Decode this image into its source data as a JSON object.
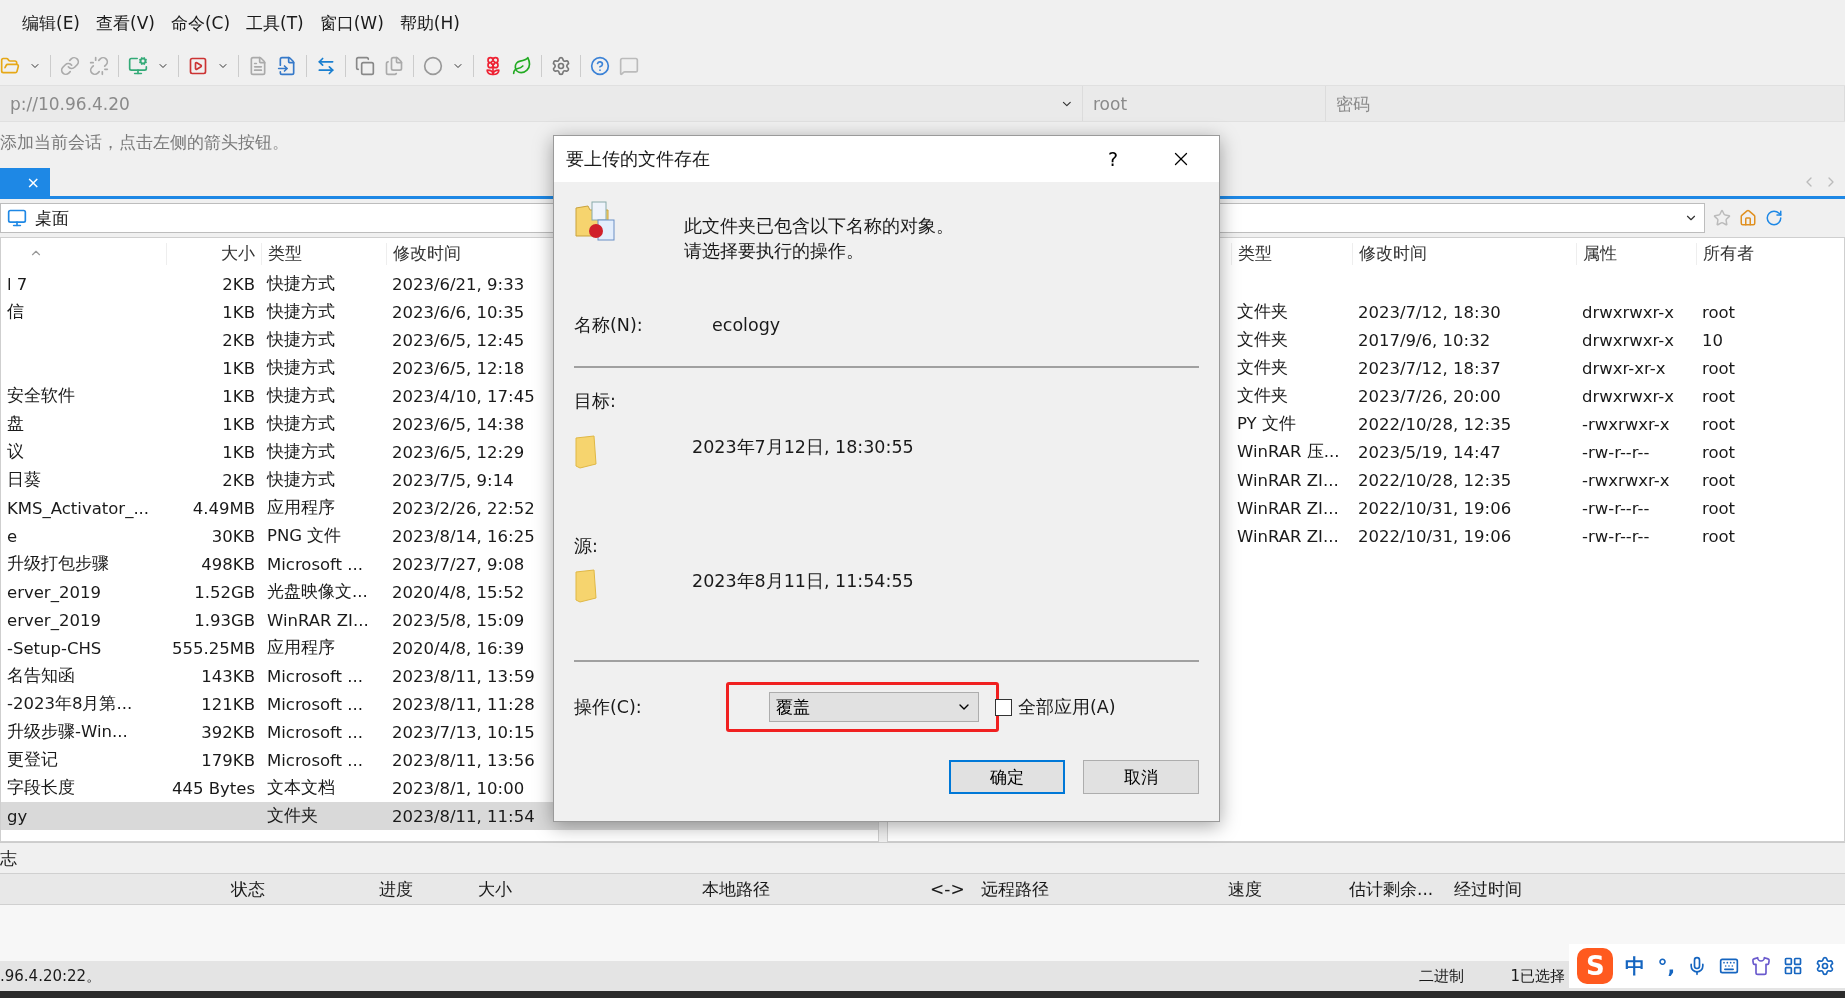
{
  "menu": [
    "编辑(E)",
    "查看(V)",
    "命令(C)",
    "工具(T)",
    "窗口(W)",
    "帮助(H)"
  ],
  "session": {
    "address": "p://10.96.4.20",
    "user": "root",
    "password_placeholder": "密码"
  },
  "hint": "添加当前会话，点击左侧的箭头按钮。",
  "session_tab": {
    "close": "×",
    "selected": true
  },
  "local_panel": {
    "path": "桌面",
    "columns": [
      "大小",
      "类型",
      "修改时间"
    ],
    "rows": [
      {
        "name": "l 7",
        "size": "2KB",
        "type": "快捷方式",
        "modified": "2023/6/21, 9:33",
        "selected": false
      },
      {
        "name": "信",
        "size": "1KB",
        "type": "快捷方式",
        "modified": "2023/6/6, 10:35",
        "selected": false
      },
      {
        "size": "2KB",
        "type": "快捷方式",
        "modified": "2023/6/5, 12:45",
        "selected": false
      },
      {
        "size": "1KB",
        "type": "快捷方式",
        "modified": "2023/6/5, 12:18",
        "selected": false
      },
      {
        "name": "安全软件",
        "size": "1KB",
        "type": "快捷方式",
        "modified": "2023/4/10, 17:45",
        "selected": false
      },
      {
        "name": "盘",
        "size": "1KB",
        "type": "快捷方式",
        "modified": "2023/6/5, 14:38",
        "selected": false
      },
      {
        "name": "议",
        "size": "1KB",
        "type": "快捷方式",
        "modified": "2023/6/5, 12:29",
        "selected": false
      },
      {
        "name": "日葵",
        "size": "2KB",
        "type": "快捷方式",
        "modified": "2023/7/5, 9:14",
        "selected": false
      },
      {
        "name": "KMS_Activator_...",
        "size": "4.49MB",
        "type": "应用程序",
        "modified": "2023/2/26, 22:52",
        "selected": false
      },
      {
        "name": "e",
        "size": "30KB",
        "type": "PNG 文件",
        "modified": "2023/8/14, 16:25",
        "selected": false
      },
      {
        "name": "升级打包步骤",
        "size": "498KB",
        "type": "Microsoft ...",
        "modified": "2023/7/27, 9:08",
        "selected": false
      },
      {
        "name": "erver_2019",
        "size": "1.52GB",
        "type": "光盘映像文...",
        "modified": "2020/4/8, 15:52",
        "selected": false
      },
      {
        "name": "erver_2019",
        "size": "1.93GB",
        "type": "WinRAR ZI...",
        "modified": "2023/5/8, 15:09",
        "selected": false
      },
      {
        "name": "-Setup-CHS",
        "size": "555.25MB",
        "type": "应用程序",
        "modified": "2020/4/8, 16:39",
        "selected": false
      },
      {
        "name": "名告知函",
        "size": "143KB",
        "type": "Microsoft ...",
        "modified": "2023/8/11, 13:59",
        "selected": false
      },
      {
        "name": "-2023年8月第...",
        "size": "121KB",
        "type": "Microsoft ...",
        "modified": "2023/8/11, 11:28",
        "selected": false
      },
      {
        "name": "升级步骤-Win...",
        "size": "392KB",
        "type": "Microsoft ...",
        "modified": "2023/7/13, 10:15",
        "selected": false
      },
      {
        "name": "更登记",
        "size": "179KB",
        "type": "Microsoft ...",
        "modified": "2023/8/11, 13:56",
        "selected": false
      },
      {
        "name": "字段长度",
        "size": "445 Bytes",
        "type": "文本文档",
        "modified": "2023/8/1, 10:00",
        "selected": false
      },
      {
        "name": "gy",
        "type": "文件夹",
        "modified": "2023/8/11, 11:54",
        "selected": true
      }
    ]
  },
  "remote_panel": {
    "columns": [
      "类型",
      "修改时间",
      "属性",
      "所有者"
    ],
    "rows": [
      {
        "type": "文件夹",
        "modified": "2023/7/12, 18:30",
        "rights": "drwxrwxr-x",
        "owner": "root"
      },
      {
        "type": "文件夹",
        "modified": "2017/9/6, 10:32",
        "rights": "drwxrwxr-x",
        "owner": "10"
      },
      {
        "type": "文件夹",
        "modified": "2023/7/12, 18:37",
        "rights": "drwxr-xr-x",
        "owner": "root"
      },
      {
        "type": "文件夹",
        "modified": "2023/7/26, 20:00",
        "rights": "drwxrwxr-x",
        "owner": "root"
      },
      {
        "type": "PY 文件",
        "modified": "2022/10/28, 12:35",
        "rights": "-rwxrwxr-x",
        "owner": "root"
      },
      {
        "type": "WinRAR 压...",
        "modified": "2023/5/19, 14:47",
        "rights": "-rw-r--r--",
        "owner": "root"
      },
      {
        "type": "WinRAR ZI...",
        "modified": "2022/10/28, 12:35",
        "rights": "-rwxrwxr-x",
        "owner": "root"
      },
      {
        "type": "WinRAR ZI...",
        "modified": "2022/10/31, 19:06",
        "rights": "-rw-r--r--",
        "owner": "root"
      },
      {
        "type": "WinRAR ZI...",
        "modified": "2022/10/31, 19:06",
        "rights": "-rw-r--r--",
        "owner": "root"
      }
    ]
  },
  "log_tab": "志",
  "transfer_columns": [
    "状态",
    "进度",
    "大小",
    "本地路径",
    "<->",
    "远程路径",
    "速度",
    "估计剩余...",
    "经过时间"
  ],
  "status_bar": {
    "connection": ".96.4.20:22。",
    "items": [
      "二进制",
      "1已选择"
    ]
  },
  "ime_logo": "S",
  "ime": [
    "中",
    "°,"
  ],
  "dialog": {
    "title": "要上传的文件存在",
    "help": "?",
    "message": [
      "此文件夹已包含以下名称的对象。",
      "请选择要执行的操作。"
    ],
    "name_label": "名称(N):",
    "name_value": "ecology",
    "target_label": "目标:",
    "target_date": "2023年7月12日, 18:30:55",
    "source_label": "源:",
    "source_date": "2023年8月11日, 11:54:55",
    "action_label": "操作(C):",
    "action_value": "覆盖",
    "apply_all": {
      "label": "全部应用(A)",
      "checked": false
    },
    "buttons": [
      {
        "label": "确定",
        "default": true
      },
      {
        "label": "取消",
        "default": false
      }
    ]
  }
}
